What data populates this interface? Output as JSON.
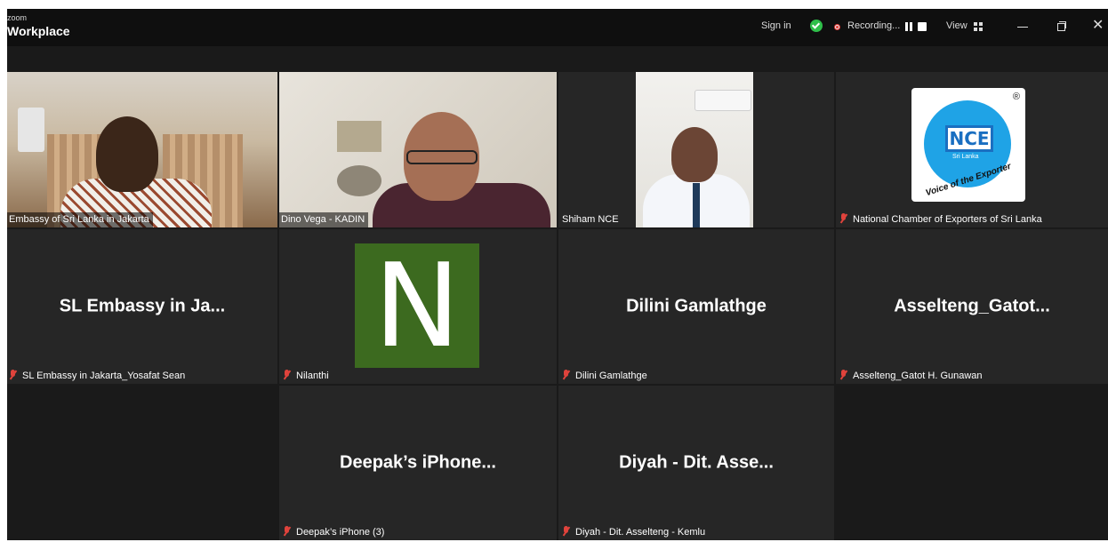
{
  "app": {
    "brand_small": "zoom",
    "brand_main": "Workplace"
  },
  "titlebar": {
    "sign_in": "Sign in",
    "recording": "Recording...",
    "view": "View"
  },
  "icons": {
    "shield": "security-shield-icon",
    "record": "record-dot-icon",
    "pause": "pause-icon",
    "stop": "stop-icon",
    "grid": "grid-view-icon",
    "minimize": "minimize-icon",
    "restore": "restore-icon",
    "close": "close-icon",
    "mic": "mic-muted-icon"
  },
  "colors": {
    "active_speaker": "#2ecc71",
    "avatar_n": "#3c6a1f",
    "muted_mic": "#e0433c",
    "nce_blue": "#1fa3e6"
  },
  "participants": [
    {
      "label": "Embassy of Sri Lanka in Jakarta",
      "muted": false,
      "video": true
    },
    {
      "label": "Dino Vega - KADIN",
      "muted": false,
      "video": true,
      "active_speaker": true
    },
    {
      "label": "Shiham NCE",
      "muted": false,
      "video": true
    },
    {
      "label": "National Chamber of Exporters of Sri Lanka",
      "muted": true,
      "video": true
    },
    {
      "display": "SL Embassy in Ja...",
      "label": "SL Embassy in Jakarta_Yosafat Sean",
      "muted": true
    },
    {
      "avatar_letter": "N",
      "label": "Nilanthi",
      "muted": true
    },
    {
      "display": "Dilini Gamlathge",
      "label": "Dilini Gamlathge",
      "muted": true
    },
    {
      "display": "Asselteng_Gatot...",
      "label": "Asselteng_Gatot H. Gunawan",
      "muted": true
    },
    {
      "display": "Deepak’s iPhone...",
      "label": "Deepak’s iPhone (3)",
      "muted": true
    },
    {
      "display": "Diyah - Dit. Asse...",
      "label": "Diyah - Dit. Asselteng - Kemlu",
      "muted": true
    }
  ],
  "nce_logo": {
    "text": "NCE",
    "sub": "Sri Lanka",
    "tagline": "Voice of the Exporter",
    "reg": "®"
  }
}
